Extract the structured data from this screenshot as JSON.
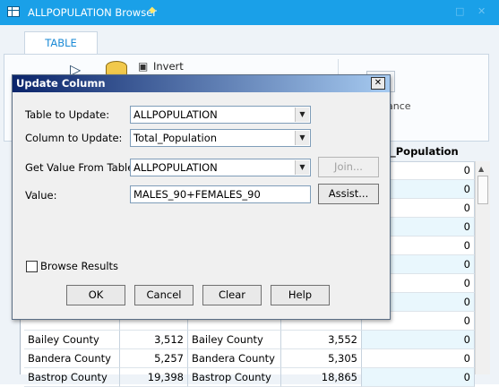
{
  "browser": {
    "title": "ALLPOPULATION Browser",
    "pin_icon": "pin-diamond-icon",
    "minimize_glyph": "□",
    "close_glyph": "✕"
  },
  "ribbon": {
    "tab_label": "TABLE",
    "invert_label": "Invert",
    "partial_label": "ance"
  },
  "grid": {
    "header_total_population": "_Population",
    "rows": [
      {
        "county": "",
        "value1": "",
        "county2": "",
        "value2": "",
        "total": "0"
      },
      {
        "county": "",
        "value1": "",
        "county2": "",
        "value2": "",
        "total": "0"
      },
      {
        "county": "",
        "value1": "",
        "county2": "",
        "value2": "",
        "total": "0"
      },
      {
        "county": "",
        "value1": "",
        "county2": "",
        "value2": "",
        "total": "0"
      },
      {
        "county": "",
        "value1": "",
        "county2": "",
        "value2": "",
        "total": "0"
      },
      {
        "county": "",
        "value1": "",
        "county2": "",
        "value2": "",
        "total": "0"
      },
      {
        "county": "",
        "value1": "",
        "county2": "",
        "value2": "",
        "total": "0"
      },
      {
        "county": "",
        "value1": "",
        "county2": "",
        "value2": "",
        "total": "0"
      },
      {
        "county": "",
        "value1": "",
        "county2": "",
        "value2": "",
        "total": "0"
      },
      {
        "county": "Bailey County",
        "value1": "3,512",
        "county2": "Bailey County",
        "value2": "3,552",
        "total": "0"
      },
      {
        "county": "Bandera County",
        "value1": "5,257",
        "county2": "Bandera County",
        "value2": "5,305",
        "total": "0"
      },
      {
        "county": "Bastrop County",
        "value1": "19,398",
        "county2": "Bastrop County",
        "value2": "18,865",
        "total": "0"
      }
    ]
  },
  "dialog": {
    "title": "Update Column",
    "close_label": "✕",
    "table_to_update_label": "Table to Update:",
    "table_to_update_value": "ALLPOPULATION",
    "column_to_update_label": "Column to Update:",
    "column_to_update_value": "Total_Population",
    "get_value_label": "Get Value From Table:",
    "get_value_value": "ALLPOPULATION",
    "join_label": "Join...",
    "value_label": "Value:",
    "value_expression": "MALES_90+FEMALES_90",
    "assist_label": "Assist...",
    "browse_results_label": "Browse Results",
    "browse_results_checked": false,
    "ok_label": "OK",
    "cancel_label": "Cancel",
    "clear_label": "Clear",
    "help_label": "Help"
  }
}
